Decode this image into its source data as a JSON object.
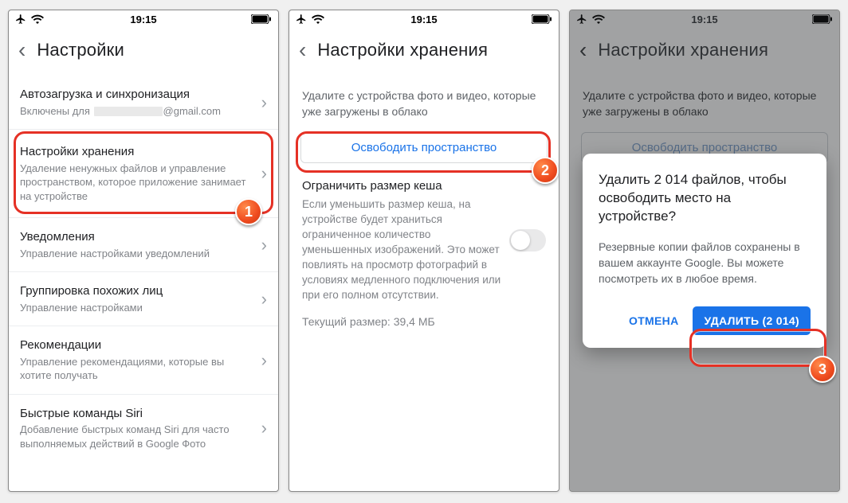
{
  "status": {
    "time": "19:15"
  },
  "panel1": {
    "header": "Настройки",
    "items": [
      {
        "title": "Автозагрузка и синхронизация",
        "sub_prefix": "Включены для",
        "sub_suffix": "@gmail.com"
      },
      {
        "title": "Настройки хранения",
        "sub": "Удаление ненужных файлов и управление пространством, которое приложение занимает на устройстве"
      },
      {
        "title": "Уведомления",
        "sub": "Управление настройками уведомлений"
      },
      {
        "title": "Группировка похожих лиц",
        "sub": "Управление настройками"
      },
      {
        "title": "Рекомендации",
        "sub": "Управление рекомендациями, которые вы хотите получать"
      },
      {
        "title": "Быстрые команды Siri",
        "sub": "Добавление быстрых команд Siri для часто выполняемых действий в Google Фото"
      }
    ]
  },
  "panel2": {
    "header": "Настройки хранения",
    "info": "Удалите с устройства фото и видео, которые уже загружены в облако",
    "free_button": "Освободить пространство",
    "cache_title": "Ограничить размер кеша",
    "cache_body": "Если уменьшить размер кеша, на устройстве будет храниться ограниченное количество уменьшенных изображений. Это может повлиять на просмотр фотографий в условиях медленного подключения или при его полном отсутствии.",
    "cache_size": "Текущий размер: 39,4 МБ"
  },
  "panel3": {
    "header": "Настройки хранения",
    "info": "Удалите с устройства фото и видео, которые уже загружены в облако",
    "ghost_button": "Освободить пространство",
    "dialog_title": "Удалить 2 014 файлов, чтобы освободить место на устройстве?",
    "dialog_body": "Резервные копии файлов сохранены в вашем аккаунте Google. Вы можете посмотреть их в любое время.",
    "cancel": "ОТМЕНА",
    "delete": "УДАЛИТЬ (2 014)"
  },
  "steps": {
    "s1": "1",
    "s2": "2",
    "s3": "3"
  }
}
